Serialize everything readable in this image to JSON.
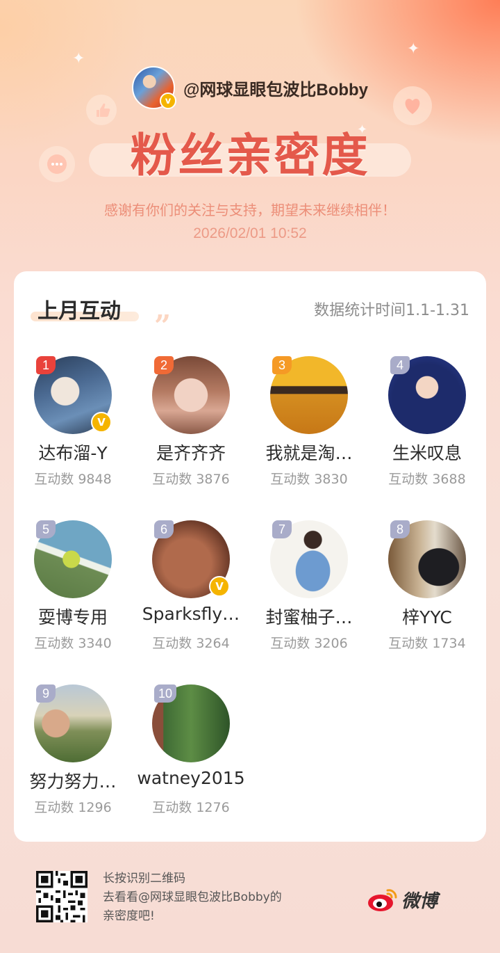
{
  "header": {
    "handle": "@网球显眼包波比Bobby",
    "verified_badge": "v",
    "title": "粉丝亲密度",
    "subtitle": "感谢有你们的关注与支持，期望未来继续相伴！",
    "datetime": "2026/02/01  10:52"
  },
  "card": {
    "title": "上月互动",
    "quote_mark": "”",
    "stat_time": "数据统计时间1.1-1.31",
    "items": [
      {
        "rank": "1",
        "name": "达布溜-Y",
        "count": "互动数 9848",
        "verified": true,
        "rank_color": "#e9423b"
      },
      {
        "rank": "2",
        "name": "是齐齐齐",
        "count": "互动数 3876",
        "verified": false,
        "rank_color": "#f06a36"
      },
      {
        "rank": "3",
        "name": "我就是淘…",
        "count": "互动数 3830",
        "verified": false,
        "rank_color": "#f59a25"
      },
      {
        "rank": "4",
        "name": "生米叹息",
        "count": "互动数 3688",
        "verified": false,
        "rank_color": "#a9acc9"
      },
      {
        "rank": "5",
        "name": "耍博专用",
        "count": "互动数 3340",
        "verified": false,
        "rank_color": "#a9acc9"
      },
      {
        "rank": "6",
        "name": "Sparksfly…",
        "count": "互动数 3264",
        "verified": true,
        "rank_color": "#a9acc9"
      },
      {
        "rank": "7",
        "name": "封蜜柚子…",
        "count": "互动数 3206",
        "verified": false,
        "rank_color": "#a9acc9"
      },
      {
        "rank": "8",
        "name": "梓YYC",
        "count": "互动数 1734",
        "verified": false,
        "rank_color": "#a9acc9"
      },
      {
        "rank": "9",
        "name": "努力努力…",
        "count": "互动数 1296",
        "verified": false,
        "rank_color": "#a9acc9"
      },
      {
        "rank": "10",
        "name": "watney2015",
        "count": "互动数 1276",
        "verified": false,
        "rank_color": "#a9acc9"
      }
    ]
  },
  "footer": {
    "line1": "长按识别二维码",
    "line2": "去看看@网球显眼包波比Bobby的",
    "line3": "亲密度吧!",
    "brand": "微博"
  },
  "colors": {
    "title": "#e4594b",
    "accent_gold": "#f5b400",
    "weibo_red": "#e6162d"
  }
}
